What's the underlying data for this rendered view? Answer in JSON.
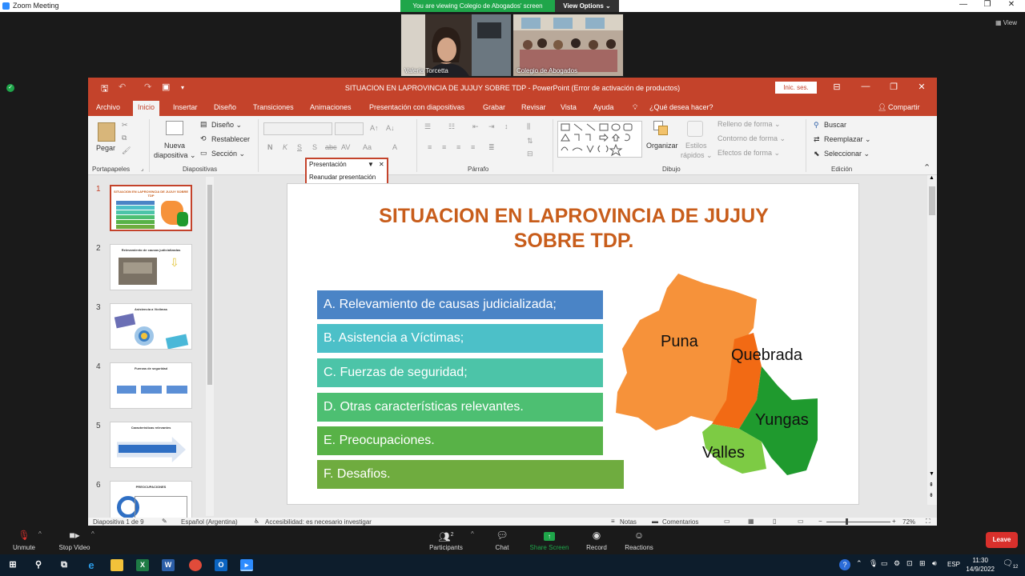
{
  "zoom": {
    "window_title": "Zoom Meeting",
    "banner_text": "You are viewing Colegio de Abogados' screen",
    "view_options": "View Options ⌄",
    "view_label": "View",
    "participants": [
      {
        "name": "Valeria Torcetta"
      },
      {
        "name": "Colegio de Abogados"
      }
    ],
    "controls": [
      {
        "label": "Unmute",
        "icon": "microphone-muted-icon"
      },
      {
        "label": "Stop Video",
        "icon": "video-icon"
      },
      {
        "label": "Participants",
        "icon": "participants-icon",
        "count": "2"
      },
      {
        "label": "Chat",
        "icon": "chat-icon"
      },
      {
        "label": "Share Screen",
        "icon": "share-screen-icon"
      },
      {
        "label": "Record",
        "icon": "record-icon"
      },
      {
        "label": "Reactions",
        "icon": "reactions-icon"
      }
    ],
    "leave_label": "Leave",
    "share_color": "#1fa64a"
  },
  "ppt": {
    "title": "SITUACION EN LAPROVINCIA DE JUJUY SOBRE TDP  -  PowerPoint (Error de activación de productos)",
    "signin": "Inic. ses.",
    "menu": [
      "Archivo",
      "Inicio",
      "Insertar",
      "Diseño",
      "Transiciones",
      "Animaciones",
      "Presentación con diapositivas",
      "Grabar",
      "Revisar",
      "Vista",
      "Ayuda"
    ],
    "tell_me": "¿Qué desea hacer?",
    "share": "Compartir",
    "ribbon": {
      "pegar": "Pegar",
      "portapapeles": "Portapapeles",
      "nueva1": "Nueva",
      "nueva2": "diapositiva ⌄",
      "diseno": "Diseño ⌄",
      "restablecer": "Restablecer",
      "seccion": "Sección ⌄",
      "diapositivas": "Diapositivas",
      "parrafo": "Párrafo",
      "organizar": "Organizar",
      "estilos1": "Estilos",
      "estilos2": "rápidos ⌄",
      "relleno": "Relleno de forma ⌄",
      "contorno": "Contorno de forma ⌄",
      "efectos": "Efectos de forma ⌄",
      "dibujo": "Dibujo",
      "buscar": "Buscar",
      "reemplazar": "Reemplazar ⌄",
      "seleccionar": "Seleccionar ⌄",
      "edicion": "Edición"
    },
    "popup": {
      "title": "Presentación",
      "action": "Reanudar presentación"
    },
    "thumbnails": [
      {
        "num": "1",
        "title": "SITUACION EN LAPROVINCIA DE JUJUY SOBRE TDP"
      },
      {
        "num": "2",
        "title": "Relevamiento de causas judicializadas"
      },
      {
        "num": "3",
        "title": "Asistencia a Víctimas"
      },
      {
        "num": "4",
        "title": "Fuerzas de seguridad"
      },
      {
        "num": "5",
        "title": "Características relevantes"
      },
      {
        "num": "6",
        "title": "PREOCUPACIONES"
      }
    ],
    "slide": {
      "title_line1": "SITUACION EN LAPROVINCIA DE JUJUY",
      "title_line2": "SOBRE TDP.",
      "items": [
        {
          "text": "A. Relevamiento de causas judicializada;",
          "color": "#4a84c6"
        },
        {
          "text": "B. Asistencia a Víctimas;",
          "color": "#4cc0c8"
        },
        {
          "text": "C. Fuerzas de seguridad;",
          "color": "#4cc4a8"
        },
        {
          "text": "D. Otras características relevantes.",
          "color": "#4dbf72"
        },
        {
          "text": "E. Preocupaciones.",
          "color": "#58b247"
        },
        {
          "text": "F. Desafios.",
          "color": "#6fac3f"
        }
      ],
      "map_labels": {
        "puna": "Puna",
        "quebrada": "Quebrada",
        "yungas": "Yungas",
        "valles": "Valles"
      }
    },
    "status": {
      "slide_of": "Diapositiva 1 de 9",
      "language": "Español (Argentina)",
      "accessibility": "Accesibilidad: es necesario investigar",
      "notes": "Notas",
      "comments": "Comentarios",
      "zoom": "72%"
    }
  },
  "taskbar": {
    "language": "ESP",
    "time": "11:30",
    "date": "14/9/2022",
    "notif": "12"
  }
}
